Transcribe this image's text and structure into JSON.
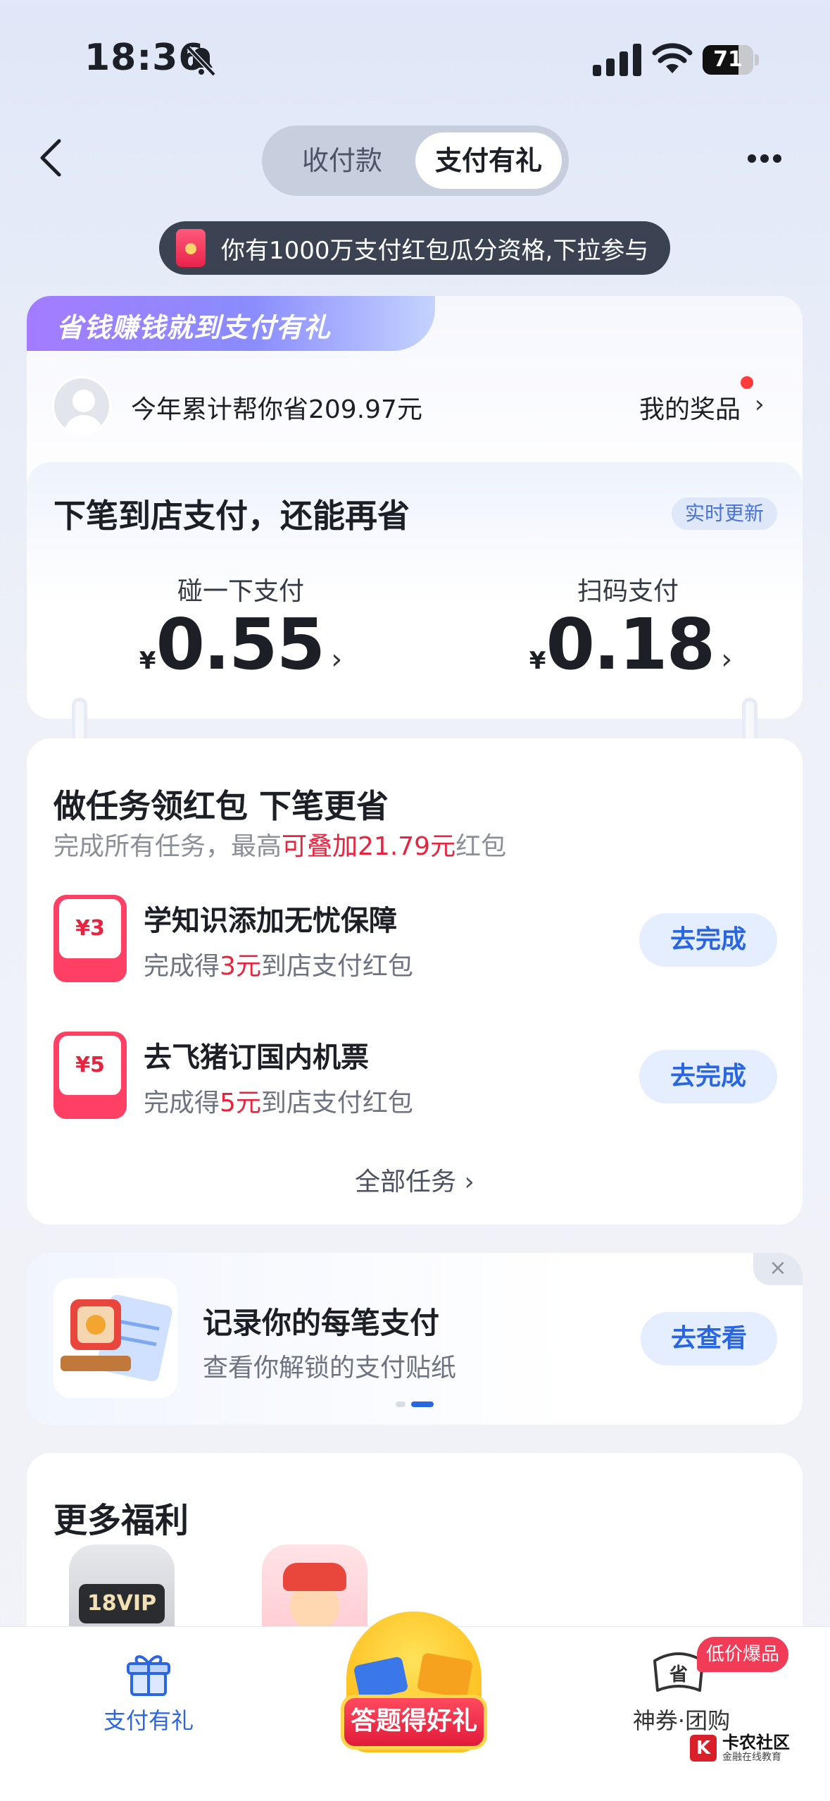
{
  "status": {
    "time": "18:36",
    "battery": "71",
    "battery_level": 0.71
  },
  "header": {
    "tabs": [
      "收付款",
      "支付有礼"
    ],
    "active_tab": 1
  },
  "promo": {
    "text": "你有1000万支付红包瓜分资格,下拉参与"
  },
  "savings_card": {
    "banner": "省钱赚钱就到支付有礼",
    "saved_text": "今年累计帮你省209.97元",
    "prize_label": "我的奖品",
    "inner_title": "下笔到店支付，还能再省",
    "realtime_badge": "实时更新",
    "methods": [
      {
        "label": "碰一下支付",
        "currency": "¥",
        "amount": "0.55"
      },
      {
        "label": "扫码支付",
        "currency": "¥",
        "amount": "0.18"
      }
    ]
  },
  "tasks_card": {
    "title": "做任务领红包 下笔更省",
    "subtitle_prefix": "完成所有任务，最高",
    "subtitle_highlight": "可叠加21.79元",
    "subtitle_suffix": "红包",
    "tasks": [
      {
        "badge": "¥3",
        "title": "学知识添加无忧保障",
        "sub_prefix": "完成得",
        "sub_amount": "3元",
        "sub_suffix": "到店支付红包",
        "button": "去完成"
      },
      {
        "badge": "¥5",
        "title": "去飞猪订国内机票",
        "sub_prefix": "完成得",
        "sub_amount": "5元",
        "sub_suffix": "到店支付红包",
        "button": "去完成"
      }
    ],
    "all_tasks": "全部任务"
  },
  "record_card": {
    "title": "记录你的每笔支付",
    "subtitle": "查看你解锁的支付贴纸",
    "button": "去查看",
    "close": "×"
  },
  "more_card": {
    "title": "更多福利",
    "vip_badge": "18VIP"
  },
  "tabbar": {
    "tab1": "支付有礼",
    "center": "答题得好礼",
    "tab3": "神券·团购",
    "tab3_badge": "低价爆品",
    "tab3_icon_glyph": "省"
  },
  "watermark": {
    "main": "卡农社区",
    "sub": "金融在线教育",
    "mark": "K"
  },
  "colors": {
    "accent_blue": "#2a66e0",
    "accent_red": "#e8233f"
  }
}
